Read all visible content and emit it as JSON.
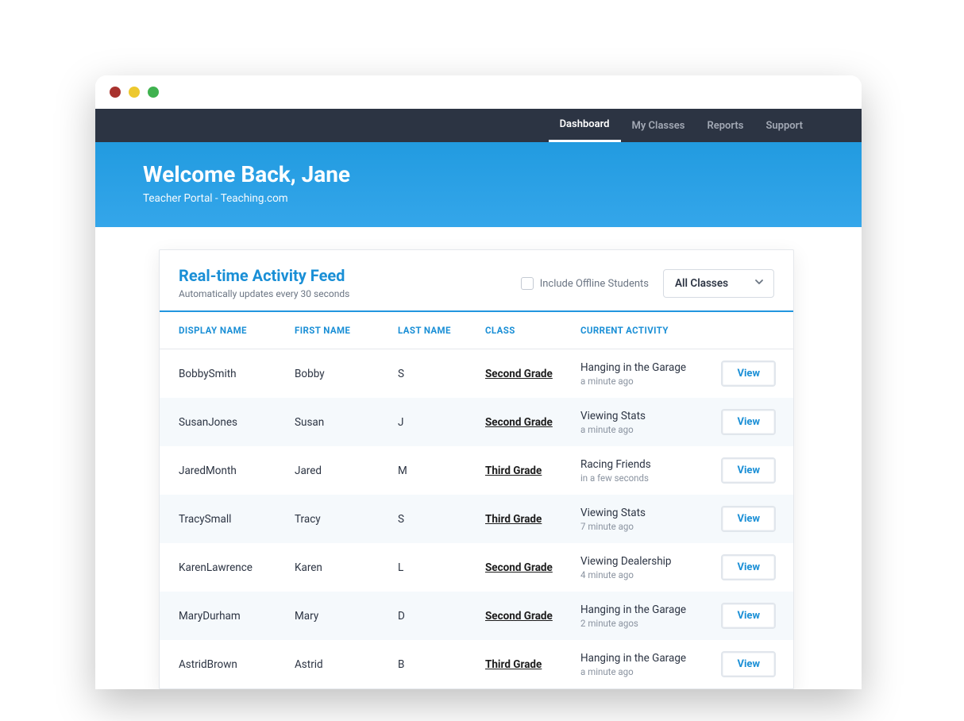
{
  "nav": {
    "items": [
      "Dashboard",
      "My Classes",
      "Reports",
      "Support"
    ],
    "active_index": 0
  },
  "hero": {
    "title": "Welcome Back, Jane",
    "subtitle": "Teacher Portal - Teaching.com"
  },
  "feed": {
    "title": "Real-time Activity Feed",
    "subtitle": "Automatically updates every 30 seconds",
    "include_offline_label": "Include Offline Students",
    "class_filter_selected": "All Classes",
    "columns": [
      "DISPLAY NAME",
      "FIRST NAME",
      "LAST NAME",
      "CLASS",
      "CURRENT ACTIVITY"
    ],
    "view_label": "View",
    "rows": [
      {
        "display": "BobbySmith",
        "first": "Bobby",
        "last": "S",
        "class": "Second Grade",
        "activity": "Hanging in the Garage",
        "time": "a minute ago"
      },
      {
        "display": "SusanJones",
        "first": "Susan",
        "last": "J",
        "class": "Second Grade",
        "activity": "Viewing Stats",
        "time": "a minute ago"
      },
      {
        "display": "JaredMonth",
        "first": "Jared",
        "last": "M",
        "class": "Third Grade",
        "activity": "Racing Friends",
        "time": "in a few seconds"
      },
      {
        "display": "TracySmall",
        "first": "Tracy",
        "last": "S",
        "class": "Third Grade",
        "activity": "Viewing Stats",
        "time": "7 minute ago"
      },
      {
        "display": "KarenLawrence",
        "first": "Karen",
        "last": "L",
        "class": "Second Grade",
        "activity": "Viewing Dealership",
        "time": "4 minute ago"
      },
      {
        "display": "MaryDurham",
        "first": "Mary",
        "last": "D",
        "class": "Second Grade",
        "activity": "Hanging in the Garage",
        "time": "2 minute agos"
      },
      {
        "display": "AstridBrown",
        "first": "Astrid",
        "last": "B",
        "class": "Third Grade",
        "activity": "Hanging in the Garage",
        "time": "a minute ago"
      }
    ]
  }
}
